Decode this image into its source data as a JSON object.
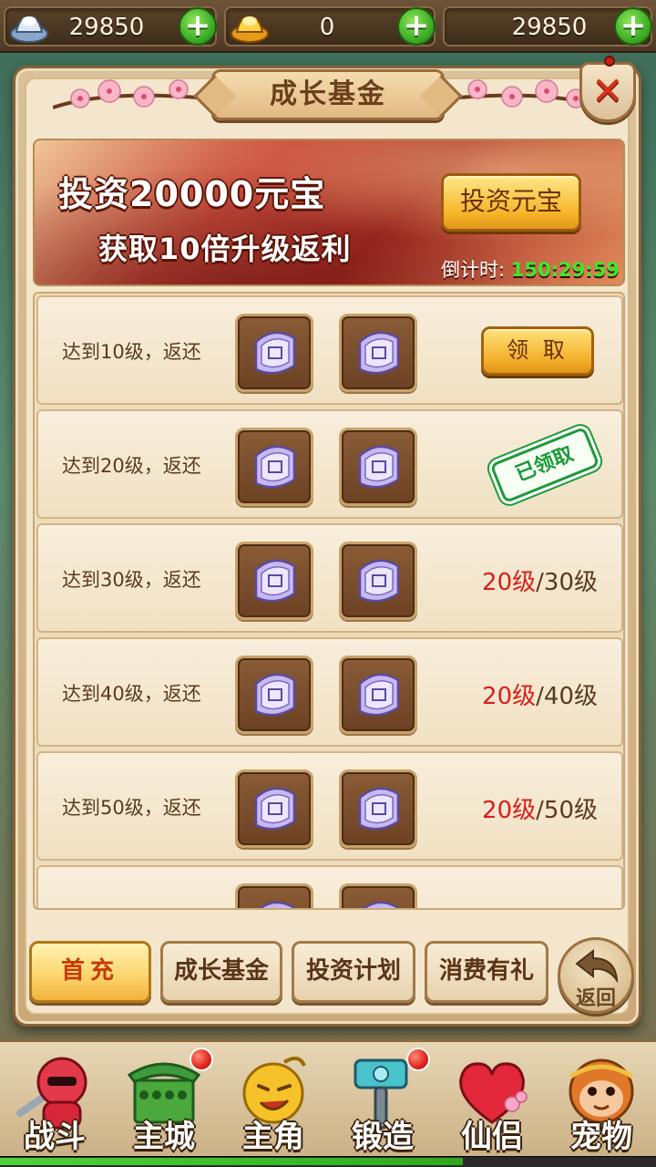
{
  "currency": {
    "silver": "29850",
    "gold": "0",
    "third": "29850"
  },
  "panel": {
    "title": "成长基金",
    "close_label": "✕"
  },
  "banner": {
    "line1": "投资20000元宝",
    "line2": "获取10倍升级返利",
    "invest_button": "投资元宝",
    "countdown_label": "倒计时:",
    "countdown_value": "150:29:59"
  },
  "rows": [
    {
      "label": "达到10级，返还",
      "action": "claim",
      "button": "领 取"
    },
    {
      "label": "达到20级，返还",
      "action": "claimed",
      "stamp": "已领取"
    },
    {
      "label": "达到30级，返还",
      "action": "progress",
      "current": "20级",
      "target": "/30级"
    },
    {
      "label": "达到40级，返还",
      "action": "progress",
      "current": "20级",
      "target": "/40级"
    },
    {
      "label": "达到50级，返还",
      "action": "progress",
      "current": "20级",
      "target": "/50级"
    }
  ],
  "tabs": {
    "first_charge": "首充",
    "growth_fund": "成长基金",
    "invest_plan": "投资计划",
    "consume_gift": "消费有礼",
    "back": "返回"
  },
  "nav": {
    "battle": "战斗",
    "city": "主城",
    "hero": "主角",
    "forge": "锻造",
    "partner": "仙侣",
    "pet": "宠物"
  },
  "colors": {
    "accent_gold": "#f3b02a",
    "progress_red": "#d8201a",
    "countdown_green": "#3ee82a",
    "stamp_green": "#1d9a3a"
  }
}
